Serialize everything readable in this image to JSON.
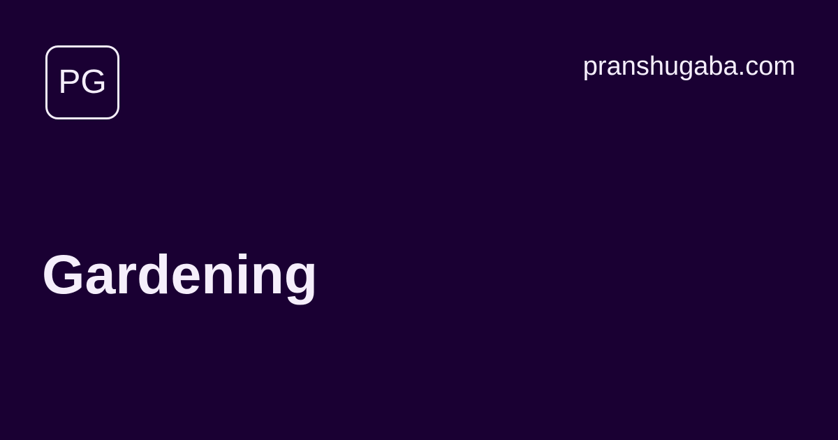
{
  "logo": {
    "text": "PG"
  },
  "header": {
    "site": "pranshugaba.com"
  },
  "main": {
    "title": "Gardening"
  },
  "colors": {
    "background": "#1a0033",
    "foreground": "#f5eefb"
  }
}
